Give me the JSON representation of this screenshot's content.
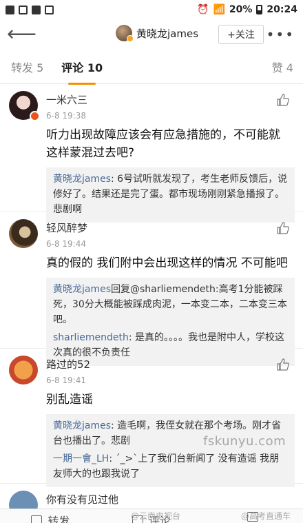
{
  "status_bar": {
    "battery": "20%",
    "time": "20:24"
  },
  "nav": {
    "title": "黄晓龙james",
    "follow_label": "+关注",
    "more": "•••"
  },
  "tabs": {
    "reposts": "转发 5",
    "comments": "评论 10",
    "likes": "赞 4"
  },
  "comments": [
    {
      "name": "一米六三",
      "time": "6-8 19:38",
      "text": "听力出现故障应该会有应急措施的，不可能就这样蒙混过去吧?",
      "replies": [
        {
          "name": "黄晓龙james",
          "text": ": 6号试听就发现了，考生老师反馈后，说修好了。结果还是完了蛋。都市现场刚刚紧急播报了。悲剧啊"
        }
      ]
    },
    {
      "name": "轻风醉梦",
      "time": "6-8 19:44",
      "text": "真的假的 我们附中会出现这样的情况 不可能吧",
      "replies": [
        {
          "name": "黄晓龙james",
          "text": "回复@sharliemendeth:高考1分能被踩死，30分大概能被踩成肉泥，一本变二本，二本变三本吧。"
        },
        {
          "name": "sharliemendeth",
          "text": ": 是真的。。。。我也是附中人，学校这次真的很不负责任"
        }
      ]
    },
    {
      "name": "路过的52",
      "time": "6-8 19:41",
      "text": "别乱造谣",
      "replies": [
        {
          "name": "黄晓龙james",
          "text": ": 造毛啊，我侄女就在那个考场。刚才省台也播出了。悲剧"
        },
        {
          "name": "一期一會_LH",
          "text": ": ´_>`上了我们台新闻了 没有造谣 我朋友师大的也跟我说了"
        }
      ]
    }
  ],
  "partial_comment_name": "你有没有见过他",
  "watermark": "fskunyu.com",
  "bottom_bar": {
    "repost": "转发",
    "comment": "评论"
  },
  "bottom_watermarks": {
    "left": "@云南电视台",
    "right": "@高考直通车"
  },
  "colors": {
    "accent": "#f29100",
    "link": "#496b97"
  }
}
